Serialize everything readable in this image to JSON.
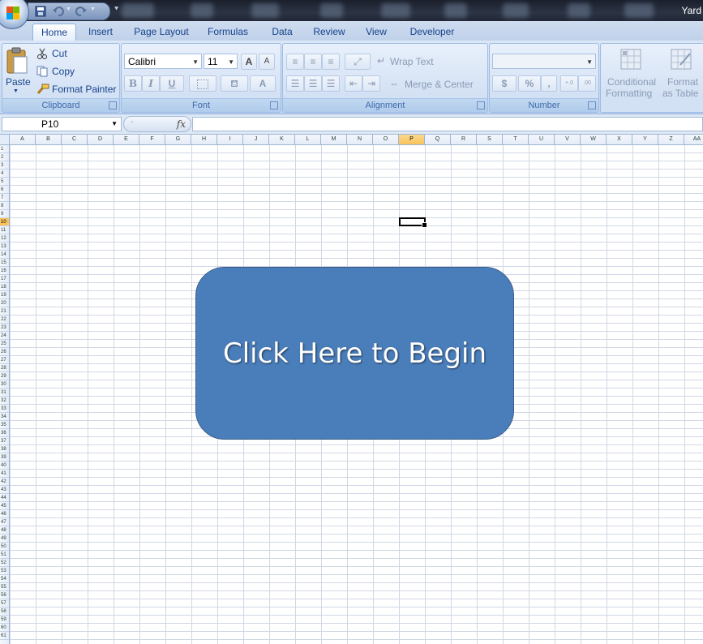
{
  "window": {
    "title": "Yard"
  },
  "tabs": [
    "Home",
    "Insert",
    "Page Layout",
    "Formulas",
    "Data",
    "Review",
    "View",
    "Developer"
  ],
  "active_tab": "Home",
  "clipboard": {
    "paste_label": "Paste",
    "cut_label": "Cut",
    "copy_label": "Copy",
    "format_painter_label": "Format Painter",
    "group_label": "Clipboard"
  },
  "font": {
    "font_name": "Calibri",
    "font_size": "11",
    "grow_label": "A",
    "shrink_label": "A",
    "bold_label": "B",
    "italic_label": "I",
    "underline_label": "U",
    "font_color_label": "A",
    "group_label": "Font"
  },
  "alignment": {
    "wrap_text_label": "Wrap Text",
    "merge_center_label": "Merge & Center",
    "group_label": "Alignment"
  },
  "number": {
    "format_value": "",
    "currency_label": "$",
    "percent_label": "%",
    "comma_label": ",",
    "increase_decimal_label": ".0→.00",
    "decrease_decimal_label": ".00→.0",
    "group_label": "Number"
  },
  "styles": {
    "conditional_label_1": "Conditional",
    "conditional_label_2": "Formatting",
    "format_table_label_1": "Format",
    "format_table_label_2": "as Table"
  },
  "formula_bar": {
    "name_box": "P10",
    "fx_label": "fx",
    "formula_value": ""
  },
  "columns": [
    "A",
    "B",
    "C",
    "D",
    "E",
    "F",
    "G",
    "H",
    "I",
    "J",
    "K",
    "L",
    "M",
    "N",
    "O",
    "P",
    "Q",
    "R",
    "S",
    "T",
    "U",
    "V",
    "W",
    "X",
    "Y",
    "Z",
    "AA"
  ],
  "selected_column": "P",
  "selected_row": 10,
  "row_count": 61,
  "shape_button": {
    "label": "Click Here to Begin",
    "fill": "#4a7ebb",
    "border": "#385d8a"
  },
  "colors": {
    "ribbon": "#c9daf1",
    "text": "#15428b",
    "selection": "#f9c25c"
  }
}
